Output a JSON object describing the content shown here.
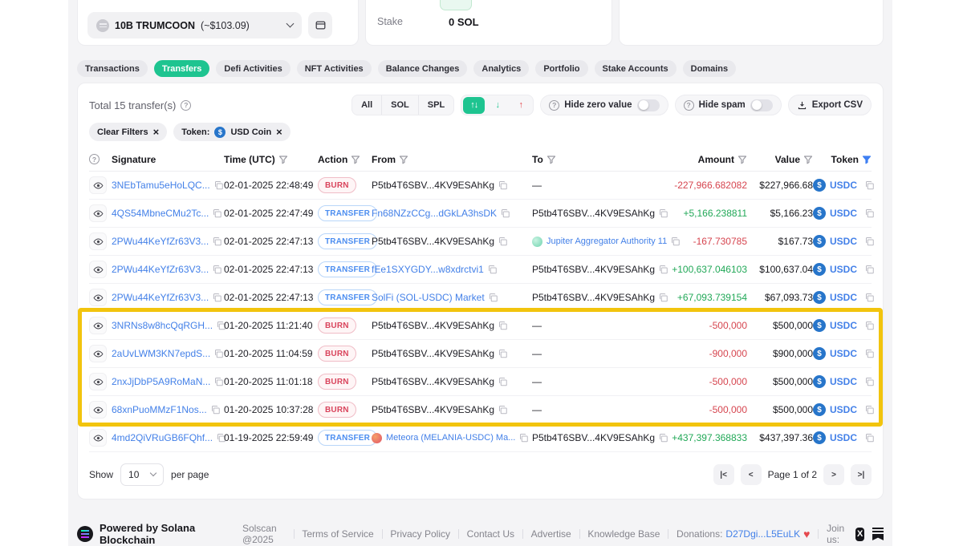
{
  "colors": {
    "accent_green": "#1ec490",
    "highlight_yellow": "#f2c40d",
    "link_blue": "#4380e8",
    "usdc_blue": "#2775ca",
    "negative_red": "#d6454f",
    "positive_green": "#21a857",
    "burn_red": "#d9445c",
    "transfer_blue": "#4b8df0"
  },
  "wallet_panel": {
    "token_selector_bold": "10B TRUMCOON",
    "token_selector_rest": "(~$103.09)"
  },
  "stake_panel": {
    "label": "Stake",
    "value": "0 SOL"
  },
  "tabs": [
    "Transactions",
    "Transfers",
    "Defi Activities",
    "NFT Activities",
    "Balance Changes",
    "Analytics",
    "Portfolio",
    "Stake Accounts",
    "Domains"
  ],
  "active_tab": "Transfers",
  "toolbar": {
    "total": "Total 15 transfer(s)",
    "filter_all": "All",
    "filter_sol": "SOL",
    "filter_spl": "SPL",
    "hide_zero": "Hide zero value",
    "hide_zero_on": false,
    "hide_spam": "Hide spam",
    "hide_spam_on": false,
    "export": "Export CSV"
  },
  "filters": {
    "clear": "Clear Filters",
    "token_label": "Token:",
    "token_name": "USD Coin"
  },
  "icons": {
    "first_col_header": "help-circle-icon",
    "row_action": "eye-icon",
    "column_filters": "funnel-icon",
    "token_filter_state": "funnel-icon-active-blue",
    "copy": "copy-icon",
    "export": "download-icon",
    "sort_active": "up-down-arrows-icon",
    "sort_asc": "down-arrow-icon",
    "sort_desc": "up-arrow-icon"
  },
  "table": {
    "header": {
      "signature": "Signature",
      "time": "Time (UTC)",
      "action": "Action",
      "from": "From",
      "to": "To",
      "amount": "Amount",
      "value": "Value",
      "token": "Token"
    },
    "rows": [
      {
        "signature": "3NEbTamu5eHoLQC...",
        "time": "02-01-2025 22:48:49",
        "action": "BURN",
        "from": "P5tb4T6SBV...4KV9ESAhKg",
        "to": "—",
        "amount": "-227,966.682082",
        "value": "$227,966.68",
        "token": "USDC"
      },
      {
        "signature": "4QS54MbneCMu2Tc...",
        "time": "02-01-2025 22:47:49",
        "action": "TRANSFER",
        "from": "Fn68NZzCCg...dGkLA3hsDK",
        "to": "P5tb4T6SBV...4KV9ESAhKg",
        "amount": "+5,166.238811",
        "value": "$5,166.23",
        "token": "USDC"
      },
      {
        "signature": "2PWu44KeYfZr63V3...",
        "time": "02-01-2025 22:47:13",
        "action": "TRANSFER",
        "from": "P5tb4T6SBV...4KV9ESAhKg",
        "to": "Jupiter Aggregator Authority 11",
        "amount": "-167.730785",
        "value": "$167.73",
        "token": "USDC"
      },
      {
        "signature": "2PWu44KeYfZr63V3...",
        "time": "02-01-2025 22:47:13",
        "action": "TRANSFER",
        "from": "fEe1SXYGDY...w8xdrctvi1",
        "to": "P5tb4T6SBV...4KV9ESAhKg",
        "amount": "+100,637.046103",
        "value": "$100,637.04",
        "token": "USDC"
      },
      {
        "signature": "2PWu44KeYfZr63V3...",
        "time": "02-01-2025 22:47:13",
        "action": "TRANSFER",
        "from": "SolFi (SOL-USDC) Market",
        "to": "P5tb4T6SBV...4KV9ESAhKg",
        "amount": "+67,093.739154",
        "value": "$67,093.73",
        "token": "USDC"
      },
      {
        "signature": "3NRNs8w8hcQqRGH...",
        "time": "01-20-2025 11:21:40",
        "action": "BURN",
        "from": "P5tb4T6SBV...4KV9ESAhKg",
        "to": "—",
        "amount": "-500,000",
        "value": "$500,000",
        "token": "USDC"
      },
      {
        "signature": "2aUvLWM3KN7epdS...",
        "time": "01-20-2025 11:04:59",
        "action": "BURN",
        "from": "P5tb4T6SBV...4KV9ESAhKg",
        "to": "—",
        "amount": "-900,000",
        "value": "$900,000",
        "token": "USDC"
      },
      {
        "signature": "2nxJjDbP5A9RoMaN...",
        "time": "01-20-2025 11:01:18",
        "action": "BURN",
        "from": "P5tb4T6SBV...4KV9ESAhKg",
        "to": "—",
        "amount": "-500,000",
        "value": "$500,000",
        "token": "USDC"
      },
      {
        "signature": "68xnPuoMMzF1Nos...",
        "time": "01-20-2025 10:37:28",
        "action": "BURN",
        "from": "P5tb4T6SBV...4KV9ESAhKg",
        "to": "—",
        "amount": "-500,000",
        "value": "$500,000",
        "token": "USDC"
      },
      {
        "signature": "4md2QiVRuGB6FQhf...",
        "time": "01-19-2025 22:59:49",
        "action": "TRANSFER",
        "from": "Meteora (MELANIA-USDC) Ma...",
        "to": "P5tb4T6SBV...4KV9ESAhKg",
        "amount": "+437,397.368833",
        "value": "$437,397.36",
        "token": "USDC"
      }
    ],
    "highlighted_rows": [
      5,
      6,
      7,
      8
    ]
  },
  "pagination": {
    "show": "Show",
    "size": "10",
    "per_page": "per page",
    "page": "Page 1 of 2"
  },
  "footer": {
    "powered": "Powered by Solana Blockchain",
    "copyright": "Solscan @2025",
    "links": [
      "Terms of Service",
      "Privacy Policy",
      "Contact Us",
      "Advertise",
      "Knowledge Base"
    ],
    "donations": "Donations:",
    "donation_address": "D27Dgi...L5EuLK",
    "join": "Join us:"
  }
}
